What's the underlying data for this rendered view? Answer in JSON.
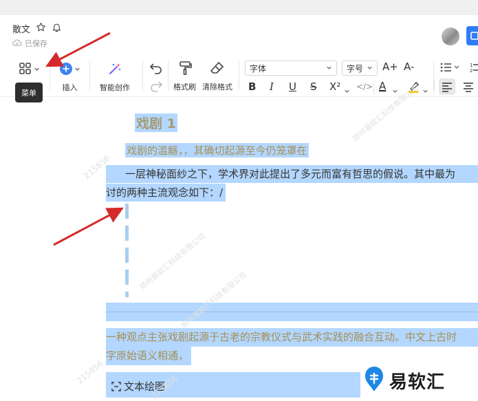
{
  "header": {
    "doc_title": "散文",
    "saved_status": "已保存"
  },
  "toolbar": {
    "menu_tooltip": "菜单",
    "insert_label": "插入",
    "ai_label": "智能创作",
    "format_painter_label": "格式刷",
    "clear_format_label": "清除格式",
    "font_select": "字体",
    "size_select": "字号",
    "bold": "B",
    "italic": "I",
    "underline": "U",
    "strike": "S",
    "superscript": "X²",
    "code": "</>",
    "font_color": "A",
    "increase_font": "A+",
    "decrease_font": "A-"
  },
  "document": {
    "heading": "戏剧 1",
    "line1": "戏剧的滥觞，，其确切起源至今仍笼罩在",
    "line2": "一层神秘面纱之下，学术界对此提出了多元而富有哲思的假说。其中最为",
    "line3": "讨的两种主流观念如下：/",
    "line4": "一种观点主张戏剧起源于古老的宗教仪式与武术实践的融合互动。中文上古时",
    "line5": "字原始语义相通，",
    "draw_card": "文本绘图"
  },
  "watermark": {
    "code": "215856",
    "company": "郑州易软汇科技有限公司"
  },
  "logo": {
    "text": "易软汇"
  },
  "colors": {
    "selection": "#b3d7ff",
    "accent": "#2f7cf6",
    "heading": "#a59a72",
    "annotation_arrow": "#d42a2a"
  }
}
